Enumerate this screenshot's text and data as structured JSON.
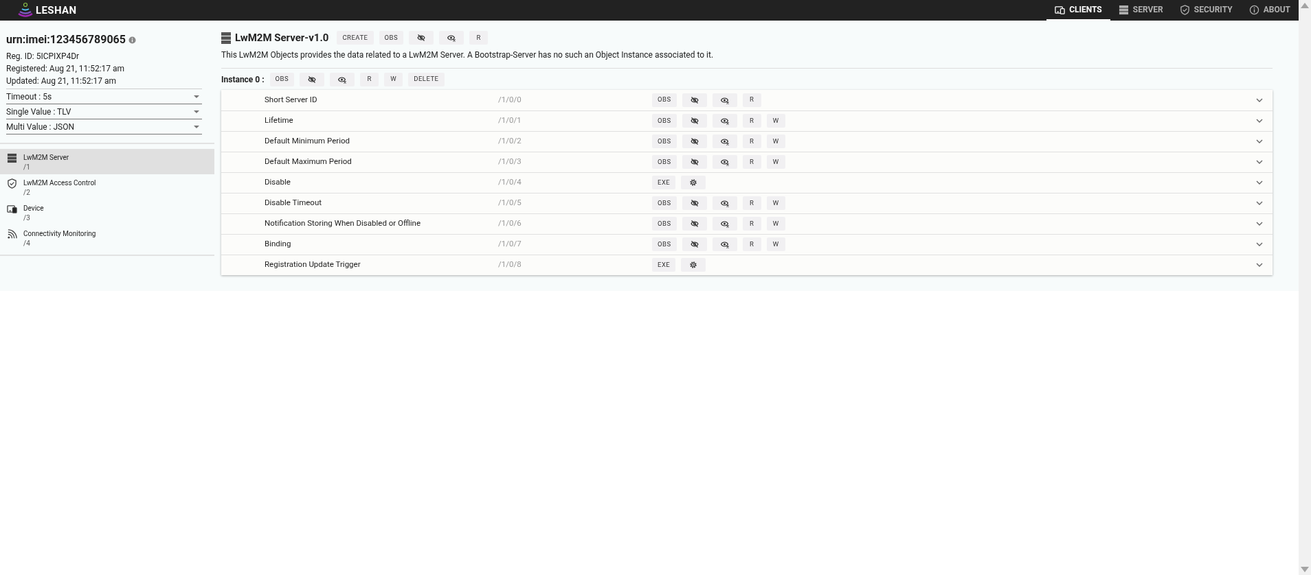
{
  "app": {
    "logo_text": "LESHAN"
  },
  "nav": [
    {
      "label": "CLIENTS",
      "selected": true
    },
    {
      "label": "SERVER",
      "selected": false
    },
    {
      "label": "SECURITY",
      "selected": false
    },
    {
      "label": "ABOUT",
      "selected": false
    }
  ],
  "client": {
    "endpoint": "urn:imei:123456789065",
    "reg_id": "Reg. ID: 5ICPIXP4Dr",
    "registered": "Registered: Aug 21, 11:52:17 am",
    "updated": "Updated: Aug 21, 11:52:17 am"
  },
  "settings": [
    {
      "label": "Timeout : 5s"
    },
    {
      "label": "Single Value : TLV"
    },
    {
      "label": "Multi Value : JSON"
    }
  ],
  "objects": [
    {
      "name": "LwM2M Server",
      "path": "/1",
      "selected": true
    },
    {
      "name": "LwM2M Access Control",
      "path": "/2",
      "selected": false
    },
    {
      "name": "Device",
      "path": "/3",
      "selected": false
    },
    {
      "name": "Connectivity Monitoring",
      "path": "/4",
      "selected": false
    }
  ],
  "object": {
    "title": "LwM2M Server-v1.0",
    "description": "This LwM2M Objects provides the data related to a LwM2M Server. A Bootstrap-Server has no such an Object Instance associated to it.",
    "buttons": [
      {
        "kind": "text",
        "label": "CREATE"
      },
      {
        "kind": "text",
        "label": "OBS"
      },
      {
        "kind": "unobserve"
      },
      {
        "kind": "cancel"
      },
      {
        "kind": "text",
        "label": "R"
      }
    ]
  },
  "instance": {
    "label": "Instance 0 :",
    "buttons": [
      {
        "kind": "text",
        "label": "OBS"
      },
      {
        "kind": "unobserve"
      },
      {
        "kind": "cancel"
      },
      {
        "kind": "text",
        "label": "R"
      },
      {
        "kind": "text",
        "label": "W"
      },
      {
        "kind": "text",
        "label": "DELETE"
      }
    ]
  },
  "resources": [
    {
      "name": "Short Server ID",
      "path": "/1/0/0",
      "buttons": [
        {
          "kind": "text",
          "label": "OBS"
        },
        {
          "kind": "unobserve"
        },
        {
          "kind": "cancel"
        },
        {
          "kind": "text",
          "label": "R"
        }
      ]
    },
    {
      "name": "Lifetime",
      "path": "/1/0/1",
      "buttons": [
        {
          "kind": "text",
          "label": "OBS"
        },
        {
          "kind": "unobserve"
        },
        {
          "kind": "cancel"
        },
        {
          "kind": "text",
          "label": "R"
        },
        {
          "kind": "text",
          "label": "W"
        }
      ]
    },
    {
      "name": "Default Minimum Period",
      "path": "/1/0/2",
      "buttons": [
        {
          "kind": "text",
          "label": "OBS"
        },
        {
          "kind": "unobserve"
        },
        {
          "kind": "cancel"
        },
        {
          "kind": "text",
          "label": "R"
        },
        {
          "kind": "text",
          "label": "W"
        }
      ]
    },
    {
      "name": "Default Maximum Period",
      "path": "/1/0/3",
      "buttons": [
        {
          "kind": "text",
          "label": "OBS"
        },
        {
          "kind": "unobserve"
        },
        {
          "kind": "cancel"
        },
        {
          "kind": "text",
          "label": "R"
        },
        {
          "kind": "text",
          "label": "W"
        }
      ]
    },
    {
      "name": "Disable",
      "path": "/1/0/4",
      "buttons": [
        {
          "kind": "text",
          "label": "EXE"
        },
        {
          "kind": "gear"
        }
      ]
    },
    {
      "name": "Disable Timeout",
      "path": "/1/0/5",
      "buttons": [
        {
          "kind": "text",
          "label": "OBS"
        },
        {
          "kind": "unobserve"
        },
        {
          "kind": "cancel"
        },
        {
          "kind": "text",
          "label": "R"
        },
        {
          "kind": "text",
          "label": "W"
        }
      ]
    },
    {
      "name": "Notification Storing When Disabled or Offline",
      "path": "/1/0/6",
      "buttons": [
        {
          "kind": "text",
          "label": "OBS"
        },
        {
          "kind": "unobserve"
        },
        {
          "kind": "cancel"
        },
        {
          "kind": "text",
          "label": "R"
        },
        {
          "kind": "text",
          "label": "W"
        }
      ]
    },
    {
      "name": "Binding",
      "path": "/1/0/7",
      "buttons": [
        {
          "kind": "text",
          "label": "OBS"
        },
        {
          "kind": "unobserve"
        },
        {
          "kind": "cancel"
        },
        {
          "kind": "text",
          "label": "R"
        },
        {
          "kind": "text",
          "label": "W"
        }
      ]
    },
    {
      "name": "Registration Update Trigger",
      "path": "/1/0/8",
      "buttons": [
        {
          "kind": "text",
          "label": "EXE"
        },
        {
          "kind": "gear"
        }
      ]
    }
  ]
}
